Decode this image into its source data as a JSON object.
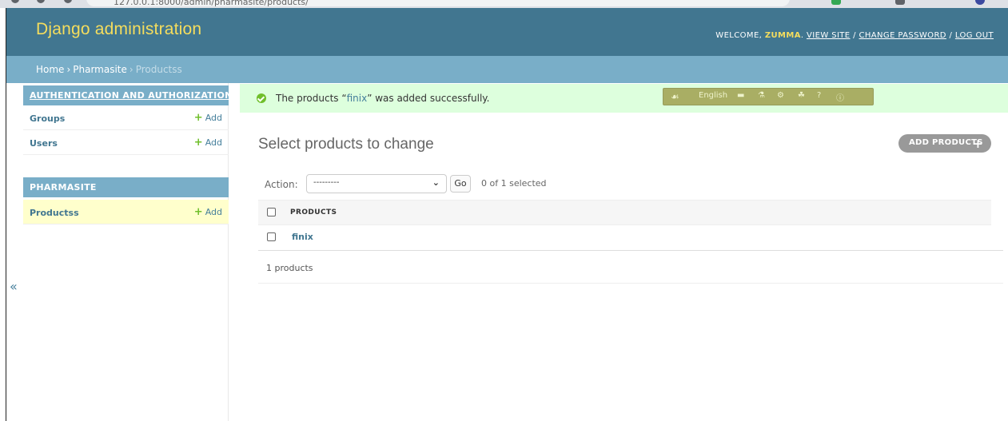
{
  "browser": {
    "url": "127.0.0.1:8000/admin/pharmasite/products/"
  },
  "header": {
    "brand": "Django administration",
    "welcome": "WELCOME,",
    "user": "ZUMMA",
    "view_site": "VIEW SITE",
    "change_password": "CHANGE PASSWORD",
    "log_out": "LOG OUT",
    "sep": "/"
  },
  "breadcrumbs": {
    "home": "Home",
    "app": "Pharmasite",
    "model": "Productss",
    "sep": "›"
  },
  "sidebar": {
    "modules": [
      {
        "caption": "AUTHENTICATION AND AUTHORIZATION",
        "rows": [
          {
            "name": "Groups",
            "add": "Add"
          },
          {
            "name": "Users",
            "add": "Add"
          }
        ]
      },
      {
        "caption": "PHARMASITE",
        "rows": [
          {
            "name": "Productss",
            "add": "Add",
            "current": true
          }
        ]
      }
    ],
    "toggle": "«"
  },
  "message": {
    "before": "The products “",
    "link": "finix",
    "after": "” was added successfully."
  },
  "debug_toolbar": {
    "language": "English"
  },
  "content": {
    "title": "Select products to change",
    "add_button": "ADD PRODUCTS",
    "action_label": "Action:",
    "action_value": "---------",
    "go": "Go",
    "selected": "0 of 1 selected",
    "column_header": "PRODUCTS",
    "rows": [
      "finix"
    ],
    "paginator": "1 products"
  },
  "colors": {
    "header": "#417690",
    "breadcrumbs": "#79aec8",
    "brand": "#f5dd5d",
    "success": "#dfd",
    "current_row": "#ffffcc",
    "add_plus": "#70bf2b"
  }
}
